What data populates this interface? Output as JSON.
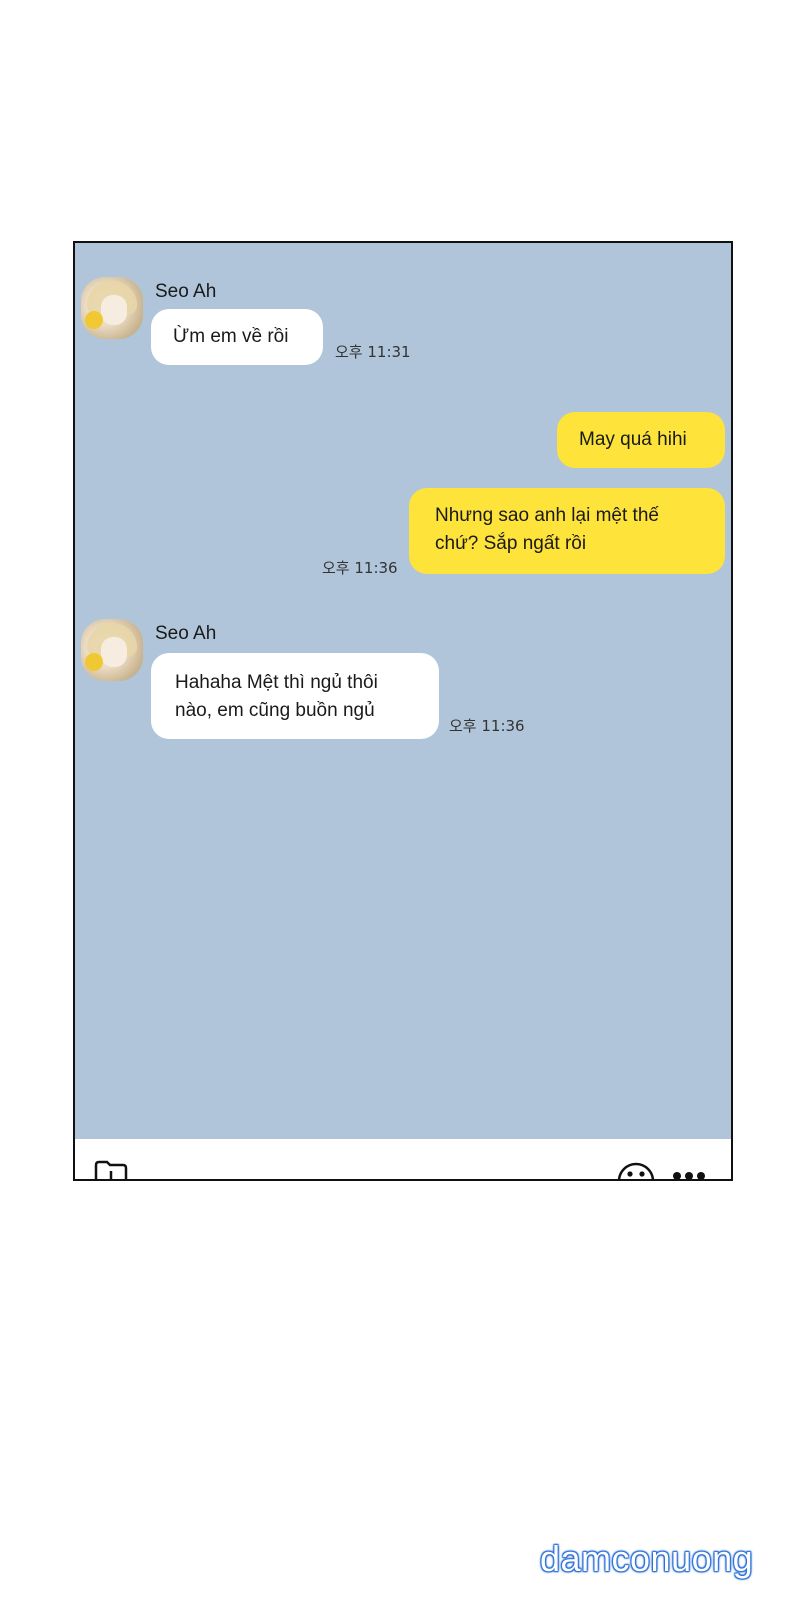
{
  "messages": [
    {
      "sender": "Seo Ah",
      "text": "Ừm em về rồi",
      "time": "오후 11:31",
      "direction": "incoming"
    },
    {
      "text": "May quá hihi",
      "direction": "outgoing"
    },
    {
      "text_line1": "Nhưng sao anh lại mệt thế",
      "text_line2": "chứ? Sắp ngất rồi",
      "time": "오후 11:36",
      "direction": "outgoing"
    },
    {
      "sender": "Seo Ah",
      "text_line1": "Hahaha Mệt thì ngủ thôi",
      "text_line2": "nào, em cũng buồn ngủ",
      "time": "오후 11:36",
      "direction": "incoming"
    }
  ],
  "toolbar": {
    "left_icon": "folder-plus-icon",
    "right_icons": [
      "emoji-icon",
      "more-icon"
    ]
  },
  "watermark": "damconuong",
  "colors": {
    "chat_background": "#b0c5d9",
    "incoming_bubble": "#ffffff",
    "outgoing_bubble": "#fde33a"
  }
}
